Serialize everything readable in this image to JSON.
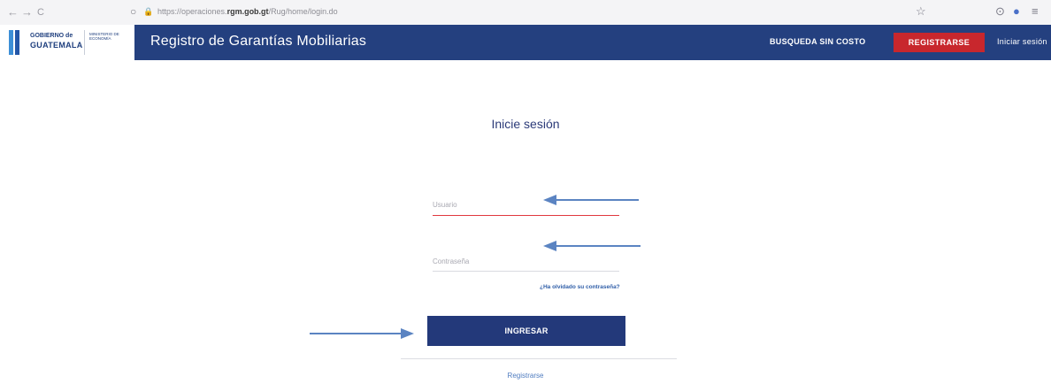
{
  "browser": {
    "back": "←",
    "forward": "→",
    "reload": "C",
    "shield": "○",
    "lock": "🔒",
    "url_prefix": "https://operaciones.",
    "url_domain": "rgm.gob.gt",
    "url_path": "/Rug/home/login.do",
    "star": "☆",
    "pocket": "⊙",
    "account": "●",
    "menu": "≡"
  },
  "header": {
    "logo_line1": "GOBIERNO de",
    "logo_line2": "GUATEMALA",
    "ministry": "MINISTERIO DE ECONOMÍA",
    "title": "Registro de Garantías Mobiliarias",
    "search_link": "BUSQUEDA SIN COSTO",
    "register_button": "REGISTRARSE",
    "login_link": "Iniciar sesión"
  },
  "login": {
    "title": "Inicie sesión",
    "username_placeholder": "Usuario",
    "password_placeholder": "Contraseña",
    "forgot_link": "¿Ha olvidado su contraseña?",
    "submit_button": "INGRESAR",
    "register_link": "Registrarse"
  },
  "colors": {
    "header_bg": "#24407f",
    "register_bg": "#c8272d",
    "button_bg": "#23397a",
    "arrow": "#5b84c2"
  }
}
